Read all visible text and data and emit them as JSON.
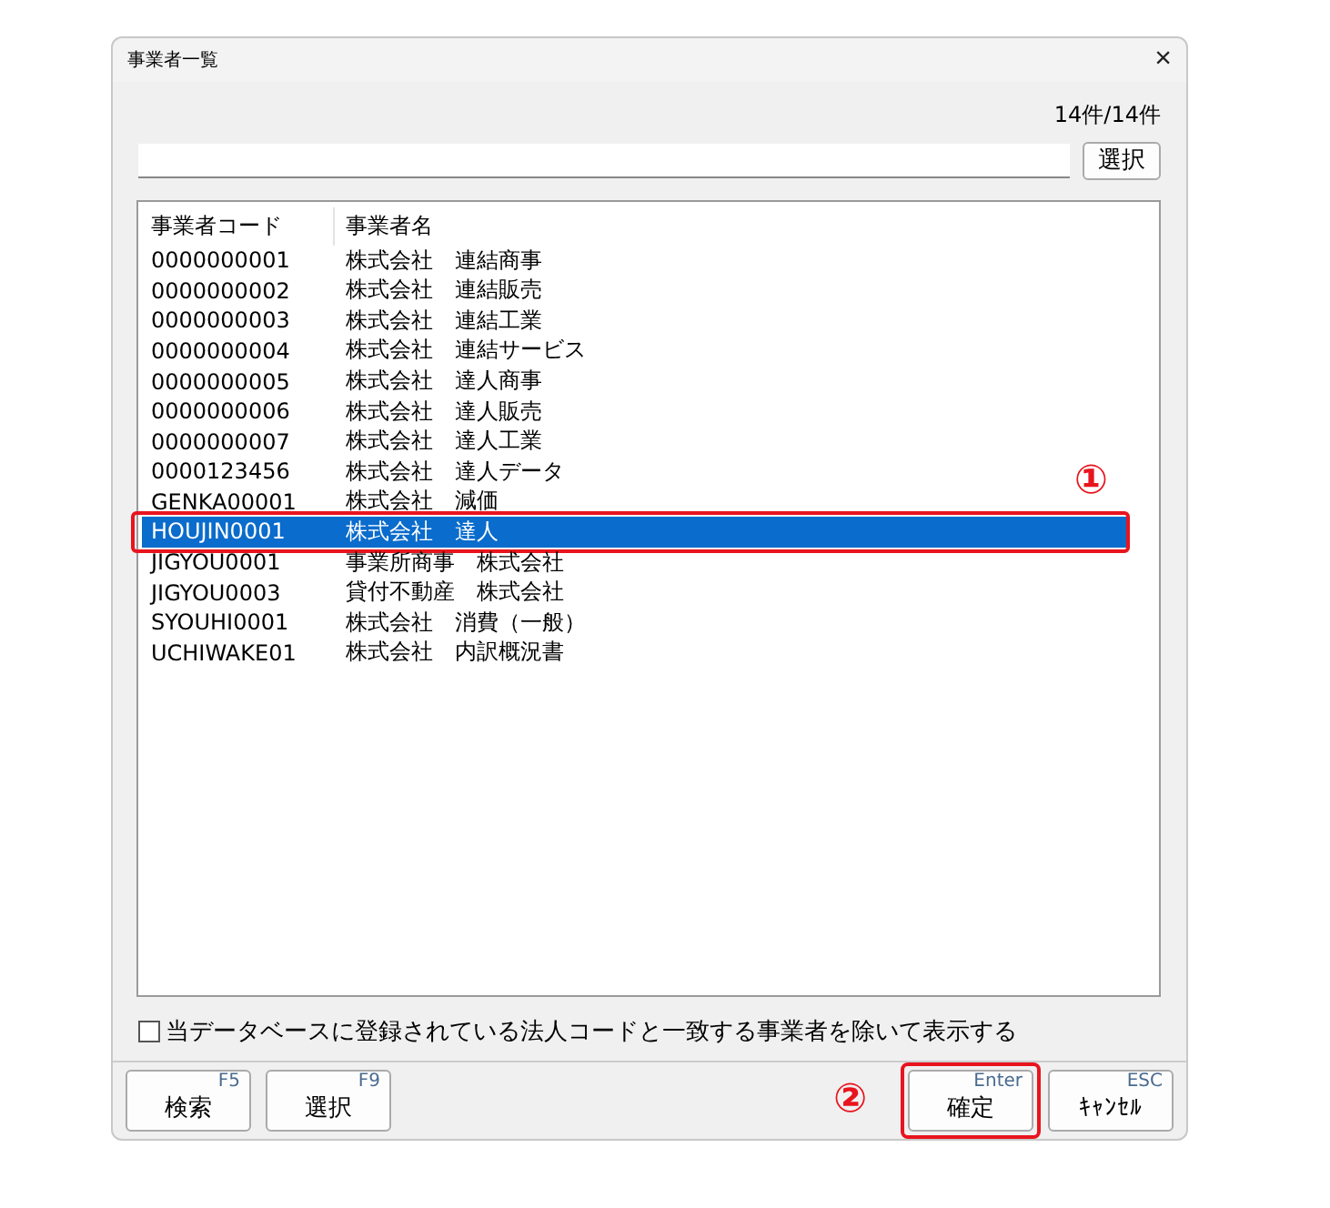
{
  "window": {
    "title": "事業者一覧",
    "close": "×"
  },
  "count": "14件/14件",
  "search": {
    "button": "選択"
  },
  "table": {
    "columns": [
      "事業者コード",
      "事業者名"
    ],
    "rows": [
      {
        "code": "0000000001",
        "name": "株式会社　連結商事",
        "selected": false
      },
      {
        "code": "0000000002",
        "name": "株式会社　連結販売",
        "selected": false
      },
      {
        "code": "0000000003",
        "name": "株式会社　連結工業",
        "selected": false
      },
      {
        "code": "0000000004",
        "name": "株式会社　連結サービス",
        "selected": false
      },
      {
        "code": "0000000005",
        "name": "株式会社　達人商事",
        "selected": false
      },
      {
        "code": "0000000006",
        "name": "株式会社　達人販売",
        "selected": false
      },
      {
        "code": "0000000007",
        "name": "株式会社　達人工業",
        "selected": false
      },
      {
        "code": "0000123456",
        "name": "株式会社　達人データ",
        "selected": false
      },
      {
        "code": "GENKA00001",
        "name": "株式会社　減価",
        "selected": false
      },
      {
        "code": "HOUJIN0001",
        "name": "株式会社　達人",
        "selected": true,
        "callout": "①"
      },
      {
        "code": "JIGYOU0001",
        "name": "事業所商事　株式会社",
        "selected": false
      },
      {
        "code": "JIGYOU0003",
        "name": "貸付不動産　株式会社",
        "selected": false
      },
      {
        "code": "SYOUHI0001",
        "name": "株式会社　消費（一般）",
        "selected": false
      },
      {
        "code": "UCHIWAKE01",
        "name": "株式会社　内訳概況書",
        "selected": false
      }
    ]
  },
  "exclude_checkbox": {
    "label": "当データベースに登録されている法人コードと一致する事業者を除いて表示する",
    "checked": false
  },
  "left_buttons": [
    {
      "key": "F5",
      "label": "検索"
    },
    {
      "key": "F9",
      "label": "選択"
    }
  ],
  "right_buttons": [
    {
      "key": "Enter",
      "label": "確定",
      "callout": "②"
    },
    {
      "key": "ESC",
      "label": "ｷｬﾝｾﾙ"
    }
  ]
}
